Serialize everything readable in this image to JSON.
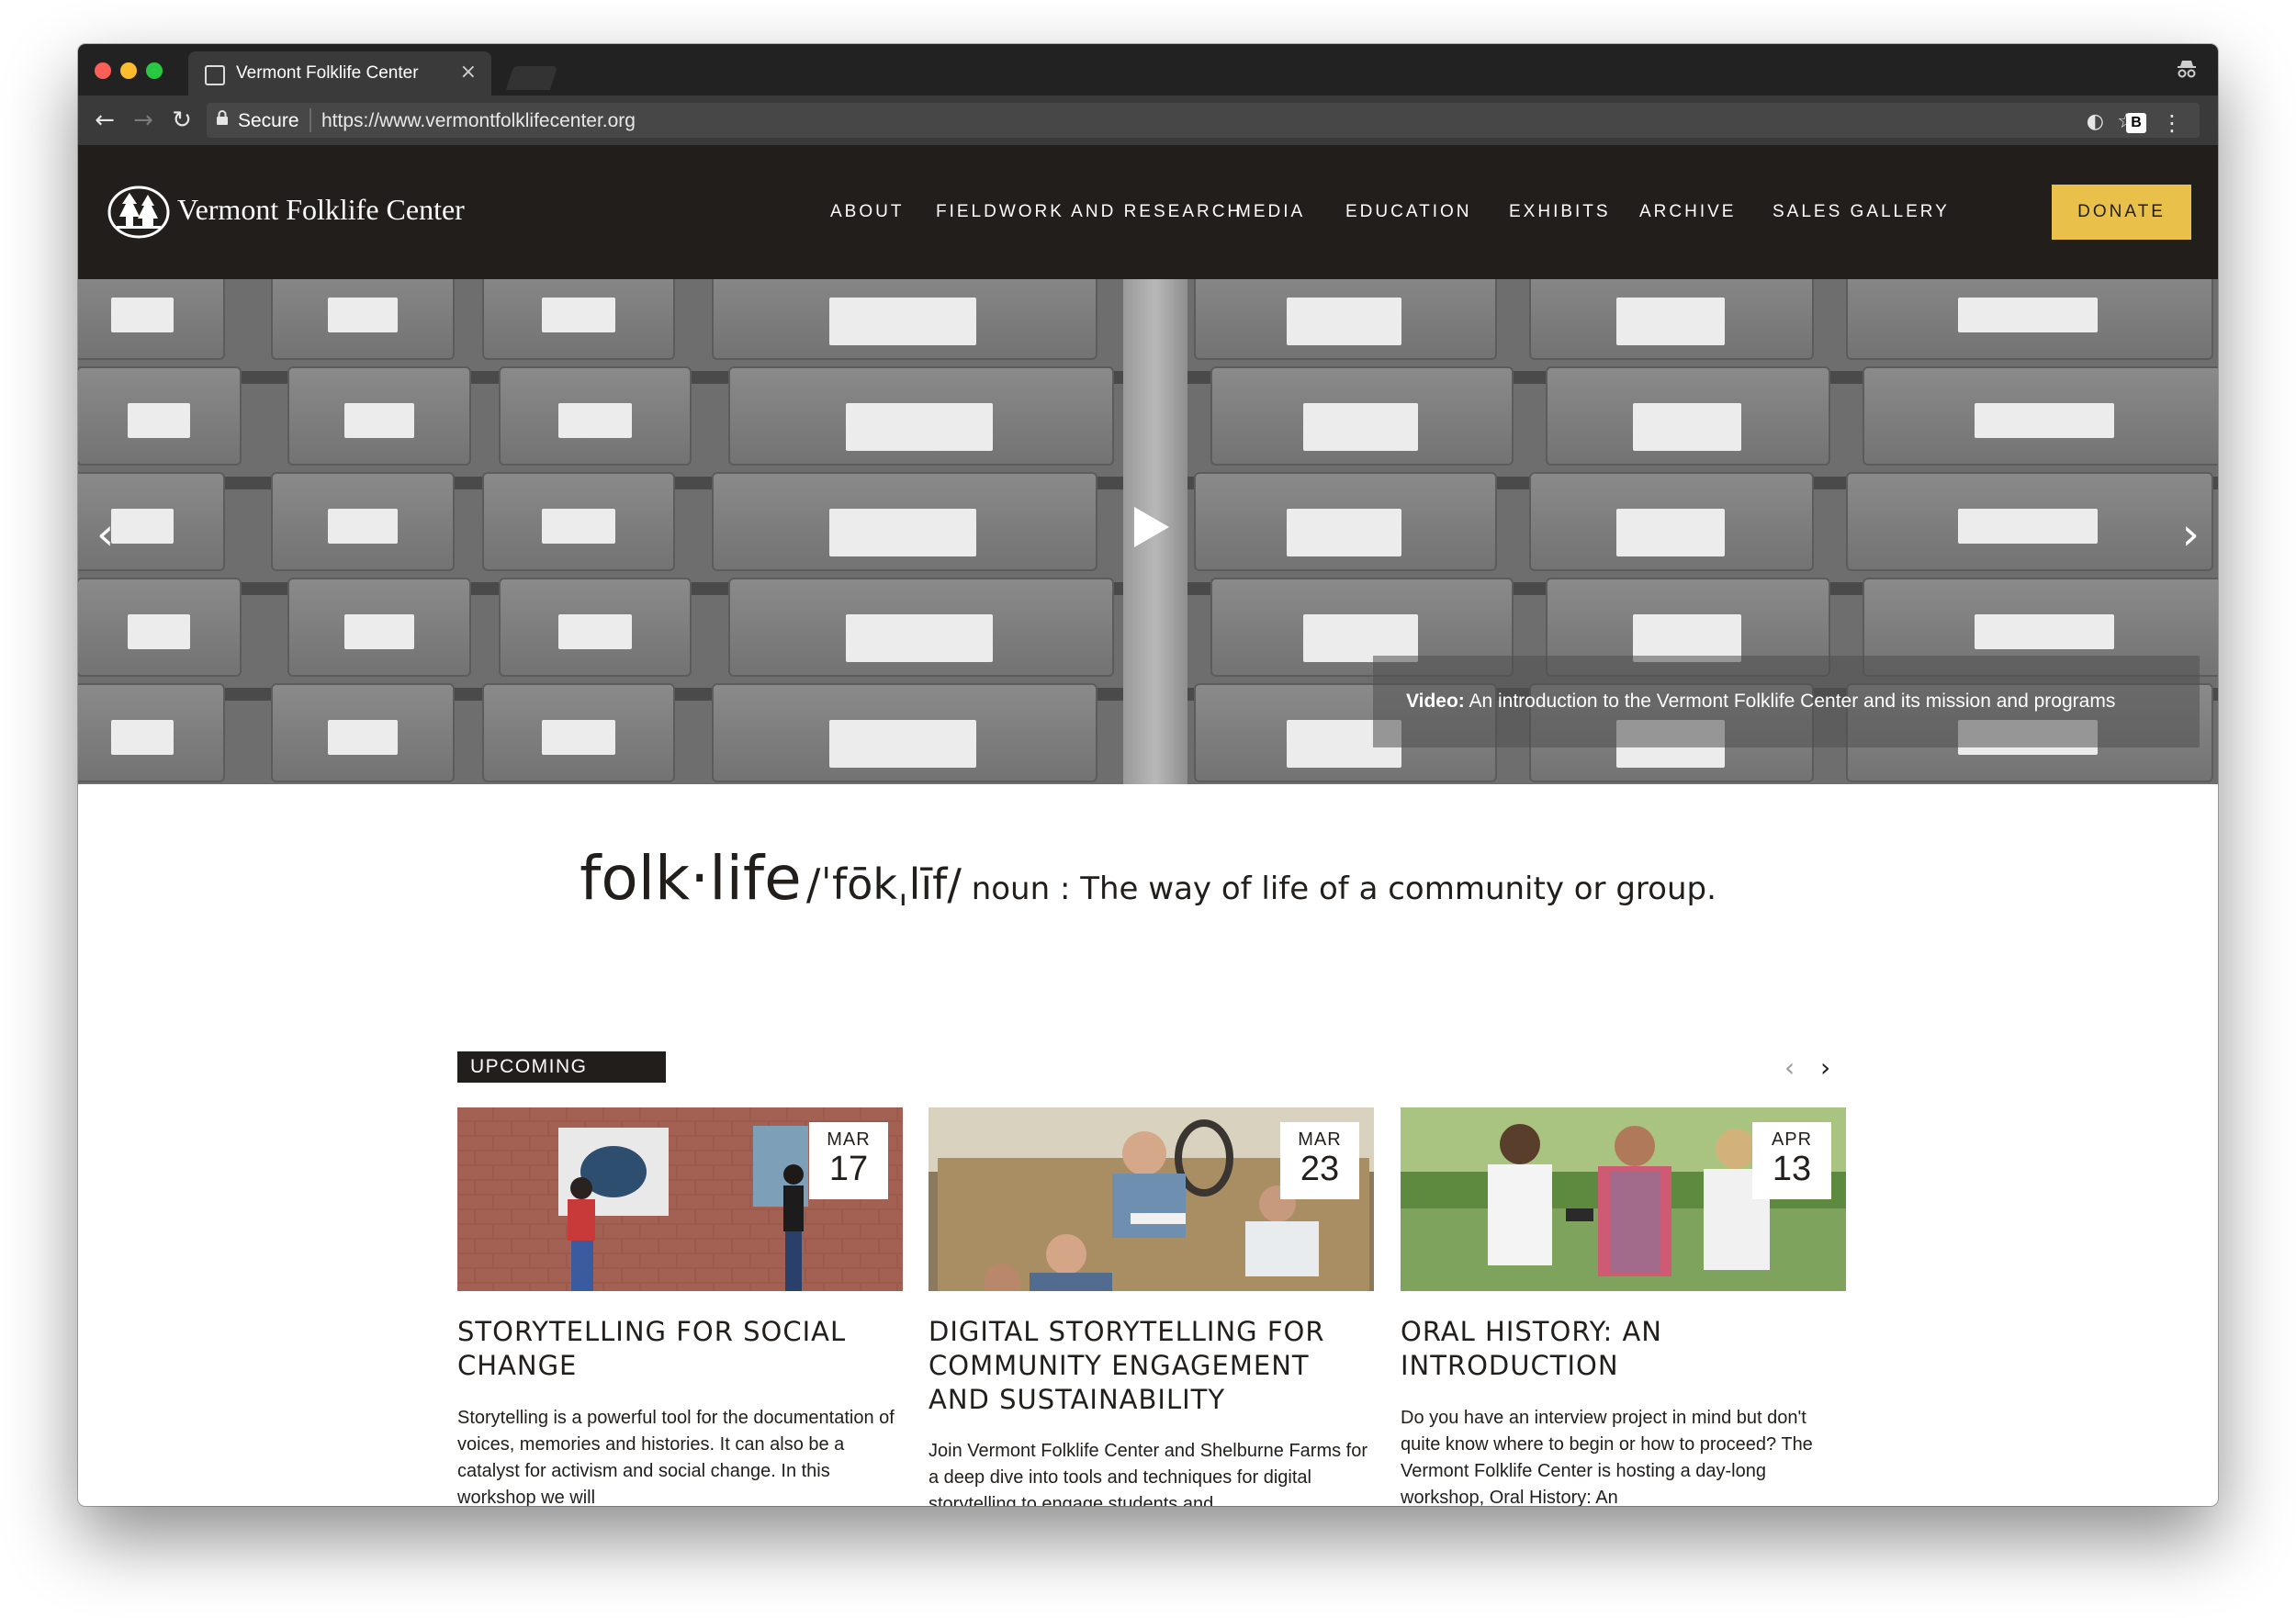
{
  "browser": {
    "tab_title": "Vermont Folklife Center",
    "tab_close": "×",
    "secure_label": "Secure",
    "url": "https://www.vermontfolklifecenter.org",
    "extension_label": "B"
  },
  "site": {
    "logo_text": "Vermont Folklife Center",
    "nav": [
      "ABOUT",
      "FIELDWORK AND RESEARCH",
      "MEDIA",
      "EDUCATION",
      "EXHIBITS",
      "ARCHIVE",
      "SALES GALLERY"
    ],
    "donate_label": "DONATE"
  },
  "hero": {
    "caption_bold": "Video:",
    "caption_text": " An introduction to the Vermont Folklife Center and its mission and programs",
    "box_labels_icon": "archive-boxes"
  },
  "definition": {
    "word": "folk·life",
    "pronunciation": "/ˈfōkˌlīf/",
    "rest": " noun : The way of life of a community or group."
  },
  "upcoming": {
    "label": "UPCOMING",
    "events": [
      {
        "month": "MAR",
        "day": "17",
        "title": "STORYTELLING FOR SOCIAL CHANGE",
        "body": "Storytelling is a powerful tool for the documentation of voices, memories and histories. It can also be a catalyst for activism and social change. In this workshop we will"
      },
      {
        "month": "MAR",
        "day": "23",
        "title": "DIGITAL STORYTELLING FOR COMMUNITY ENGAGEMENT AND SUSTAINABILITY",
        "body": "Join Vermont Folklife Center and Shelburne Farms for a deep dive into tools and techniques for digital storytelling to engage students and"
      },
      {
        "month": "APR",
        "day": "13",
        "title": "ORAL HISTORY: AN INTRODUCTION",
        "body": "Do you have an interview project in mind but don't quite know where to begin or how to proceed? The Vermont Folklife Center is hosting a day-long workshop, Oral History: An"
      }
    ]
  },
  "colors": {
    "header_bg": "#211e1b",
    "donate_bg": "#e8c04a",
    "text": "#211e1b"
  }
}
